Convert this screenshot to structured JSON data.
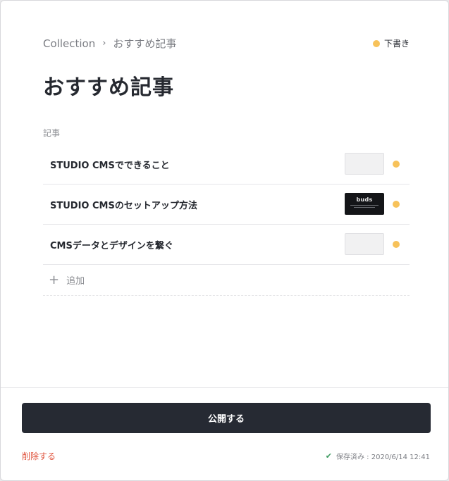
{
  "breadcrumb": {
    "root": "Collection",
    "separator": "›",
    "current": "おすすめ記事"
  },
  "status": {
    "label": "下書き",
    "color": "#f7c25a"
  },
  "page": {
    "title": "おすすめ記事"
  },
  "field": {
    "label": "記事"
  },
  "articles": [
    {
      "title": "STUDIO CMSでできること",
      "thumbnail": "empty",
      "status_color": "#f7c25a"
    },
    {
      "title": "STUDIO CMSのセットアップ方法",
      "thumbnail": "buds",
      "thumbnail_text": "buds",
      "status_color": "#f7c25a"
    },
    {
      "title": "CMSデータとデザインを繋ぐ",
      "thumbnail": "empty",
      "status_color": "#f7c25a"
    }
  ],
  "add": {
    "icon": "plus-icon",
    "label": "追加"
  },
  "footer": {
    "publish_label": "公開する",
    "delete_label": "削除する",
    "saved_icon": "check-icon",
    "saved_label": "保存済み : 2020/6/14 12:41"
  },
  "colors": {
    "primary_button": "#262a33",
    "danger": "#e0553f",
    "success": "#3c9a5f",
    "draft": "#f7c25a"
  }
}
